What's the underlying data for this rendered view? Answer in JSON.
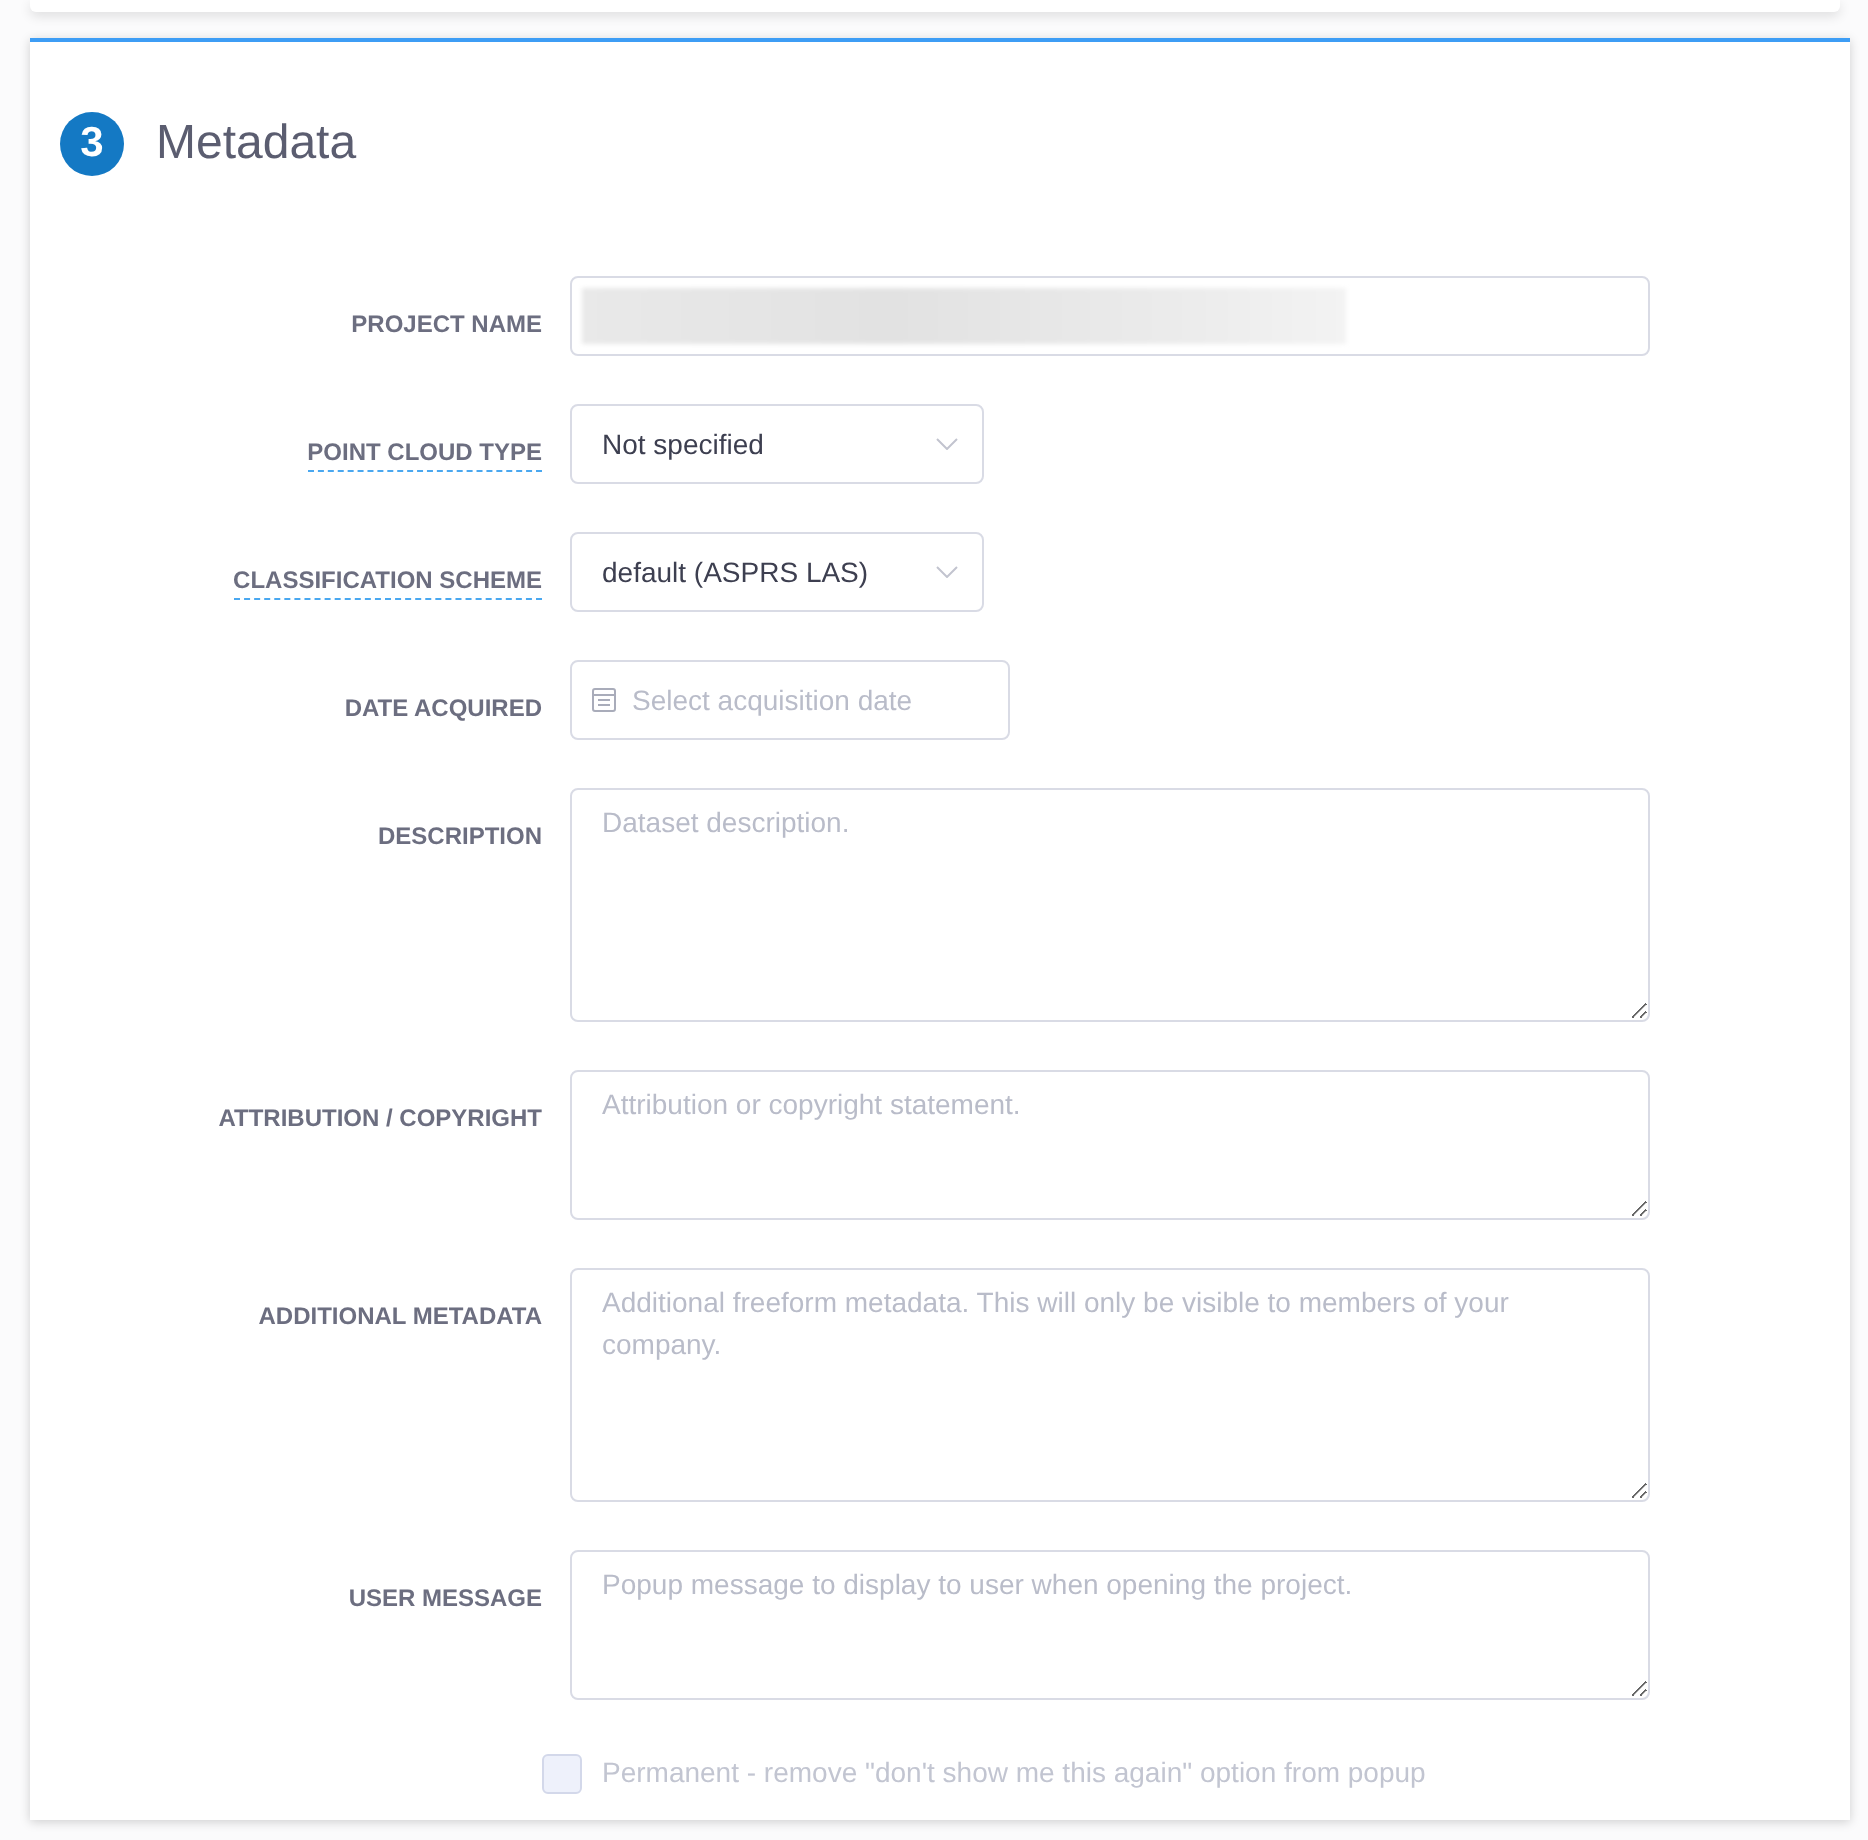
{
  "section": {
    "number": "3",
    "title": "Metadata"
  },
  "fields": [
    {
      "kind": "text",
      "label": "PROJECT NAME",
      "tooltip": false,
      "redacted": true
    },
    {
      "kind": "select",
      "label": "POINT CLOUD TYPE",
      "tooltip": true,
      "value": "Not specified"
    },
    {
      "kind": "select",
      "label": "CLASSIFICATION SCHEME",
      "tooltip": true,
      "value": "default (ASPRS LAS)"
    },
    {
      "kind": "date",
      "label": "DATE ACQUIRED",
      "tooltip": false,
      "placeholder": "Select acquisition date"
    },
    {
      "kind": "textarea",
      "label": "DESCRIPTION",
      "tooltip": false,
      "tall": true,
      "placeholder": "Dataset description."
    },
    {
      "kind": "textarea",
      "label": "ATTRIBUTION / COPYRIGHT",
      "tooltip": false,
      "tall": false,
      "placeholder": "Attribution or copyright statement."
    },
    {
      "kind": "textarea",
      "label": "ADDITIONAL METADATA",
      "tooltip": false,
      "tall": true,
      "placeholder": "Additional freeform metadata. This will only be visible to members of your company."
    },
    {
      "kind": "textarea",
      "label": "USER MESSAGE",
      "tooltip": false,
      "tall": false,
      "placeholder": "Popup message to display to user when opening the project."
    }
  ],
  "checkbox": {
    "label": "Permanent - remove \"don't show me this again\" option from popup",
    "checked": false,
    "disabled": true
  }
}
